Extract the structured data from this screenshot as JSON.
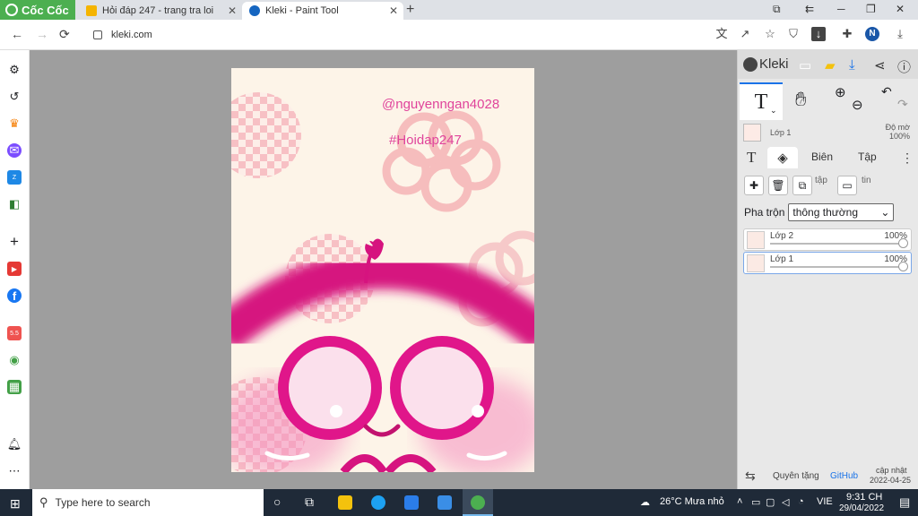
{
  "browser": {
    "brand": "Cốc Cốc",
    "tabs": [
      {
        "title": "Hỏi đáp 247 - trang tra loi",
        "icon": "hoidap-favicon"
      },
      {
        "title": "Kleki - Paint Tool",
        "icon": "kleki-favicon",
        "active": true
      }
    ],
    "new_tab": "+",
    "url": "kleki.com",
    "avatar_initial": "N",
    "accent": "#4caf50"
  },
  "sidebar": {
    "items": [
      "settings-icon",
      "history-icon",
      "crown-icon",
      "messenger-icon",
      "zalo-icon",
      "game-icon",
      "add-icon",
      "youtube-icon",
      "facebook-icon",
      "shop-icon",
      "maps-icon",
      "sheets-icon",
      "bell-icon",
      "more-icon"
    ]
  },
  "canvas": {
    "watermark_user": "@nguyenngan4028",
    "watermark_tag": "#Hoidap247",
    "background": "#fdf4e8",
    "pink": "#e0168a"
  },
  "kleki": {
    "logo": "Kleki",
    "current_tool": "T",
    "layer_name": "Lớp 1",
    "opacity_label": "Độ mờ",
    "opacity_value": "100%",
    "tabs": {
      "text_tab": "T",
      "edit": "Biên",
      "file": "Tập"
    },
    "btn_label_1": "tập",
    "btn_label_2": "tin",
    "blend_label": "Pha trộn",
    "blend_value": "thông thường",
    "layers": [
      {
        "name": "Lớp 2",
        "opacity": "100%"
      },
      {
        "name": "Lớp 1",
        "opacity": "100%",
        "selected": true
      }
    ],
    "footer": {
      "donate": "Quyên tặng",
      "github": "GitHub",
      "updated_label": "cập nhật",
      "updated_date": "2022-04-25"
    }
  },
  "taskbar": {
    "search_placeholder": "Type here to search",
    "weather": "26°C  Mưa nhỏ",
    "lang": "VIE",
    "time": "9:31 CH",
    "date": "29/04/2022"
  }
}
